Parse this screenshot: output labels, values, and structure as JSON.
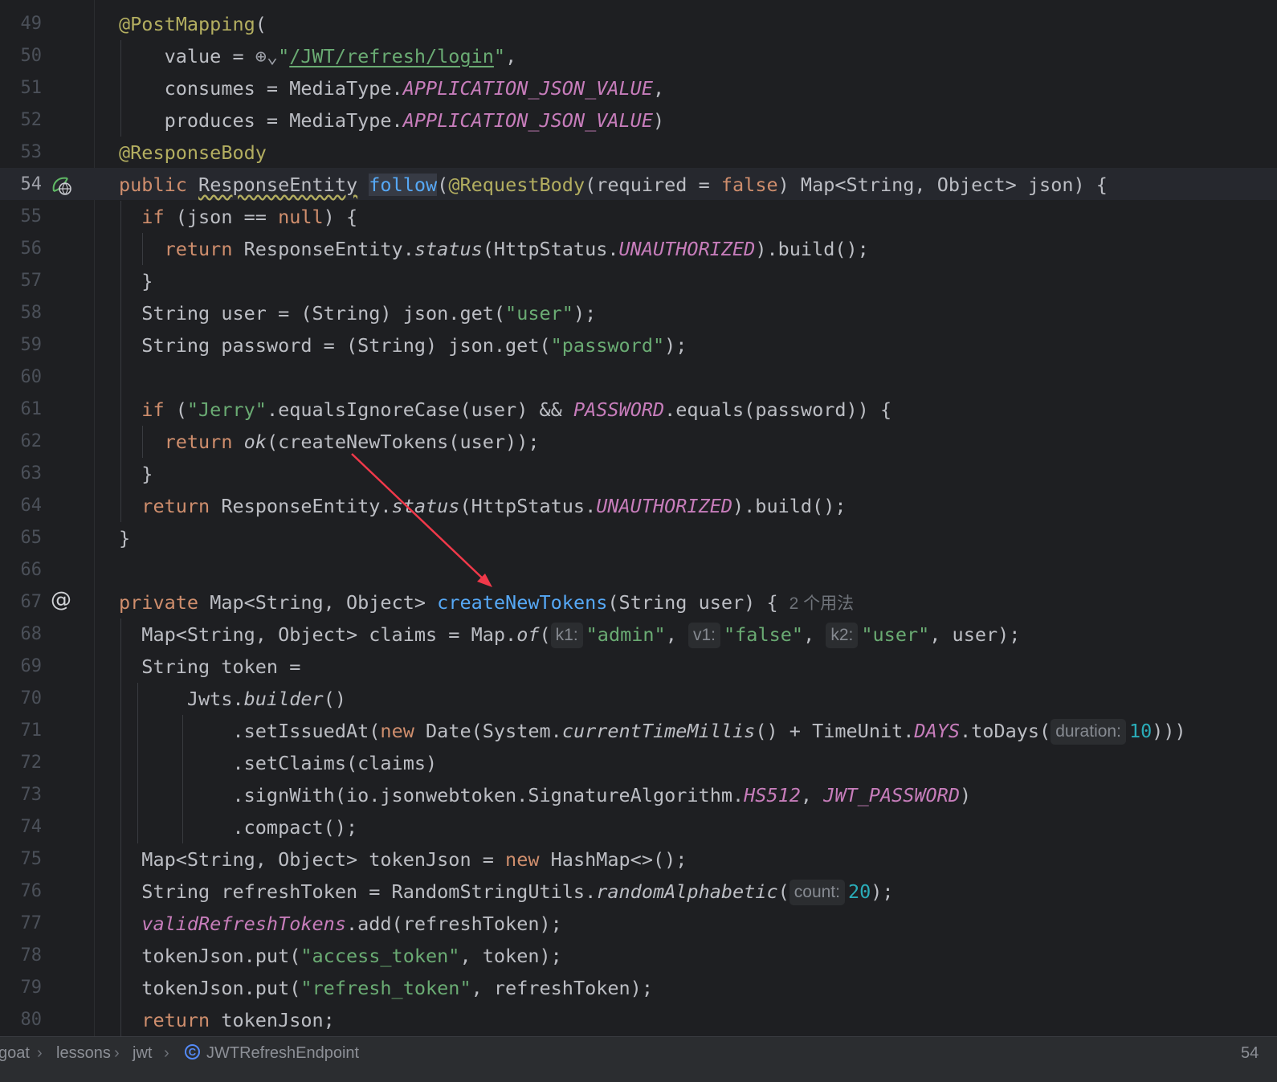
{
  "editor": {
    "lines": [
      {
        "n": "49",
        "html": "<span class=\"ann\">@PostMapping</span>("
      },
      {
        "n": "50",
        "html": "    value = <span data-name=\"globe-icon\" data-interactable=\"true\" style=\"color:#9da0a8\">⊕⌄</span><span class=\"str\">\"<span class=\"link\">/JWT/refresh/login</span>\"</span>,"
      },
      {
        "n": "51",
        "html": "    consumes = MediaType.<span class=\"cst\">APPLICATION_JSON_VALUE</span>,"
      },
      {
        "n": "52",
        "html": "    produces = MediaType.<span class=\"cst\">APPLICATION_JSON_VALUE</span>)"
      },
      {
        "n": "53",
        "html": "<span class=\"ann\">@ResponseBody</span>"
      },
      {
        "n": "54",
        "html": "<span class=\"kw\">public</span> <span class=\"wavy\">ResponseEntity</span> <span class=\"fn hl\">follow</span>(<span class=\"ann\">@RequestBody</span>(required = <span class=\"kw\">false</span>) Map&lt;String, Object&gt; json) {"
      },
      {
        "n": "55",
        "html": "  <span class=\"kw\">if</span> (json == <span class=\"kw\">null</span>) {"
      },
      {
        "n": "56",
        "html": "    <span class=\"kw\">return</span> ResponseEntity.<span class=\"it\">status</span>(HttpStatus.<span class=\"cst\">UNAUTHORIZED</span>).build();"
      },
      {
        "n": "57",
        "html": "  }"
      },
      {
        "n": "58",
        "html": "  String user = (String) json.get(<span class=\"str\">\"user\"</span>);"
      },
      {
        "n": "59",
        "html": "  String password = (String) json.get(<span class=\"str\">\"password\"</span>);"
      },
      {
        "n": "60",
        "html": ""
      },
      {
        "n": "61",
        "html": "  <span class=\"kw\">if</span> (<span class=\"str\">\"Jerry\"</span>.equalsIgnoreCase(user) &amp;&amp; <span class=\"cst\">PASSWORD</span>.equals(password)) {"
      },
      {
        "n": "62",
        "html": "    <span class=\"kw\">return</span> <span class=\"it\">ok</span>(createNewTokens(user));"
      },
      {
        "n": "63",
        "html": "  }"
      },
      {
        "n": "64",
        "html": "  <span class=\"kw\">return</span> ResponseEntity.<span class=\"it\">status</span>(HttpStatus.<span class=\"cst\">UNAUTHORIZED</span>).build();"
      },
      {
        "n": "65",
        "html": "}"
      },
      {
        "n": "66",
        "html": ""
      },
      {
        "n": "67",
        "html": "<span class=\"kw\">private</span> Map&lt;String, Object&gt; <span class=\"fn\">createNewTokens</span>(String user) {<span class=\"usage\">2 个用法</span>"
      },
      {
        "n": "68",
        "html": "  Map&lt;String, Object&gt; claims = Map.<span class=\"it\">of</span>(<span class=\"hint\">k1:</span><span class=\"str\">\"admin\"</span>, <span class=\"hint\">v1:</span><span class=\"str\">\"false\"</span>, <span class=\"hint\">k2:</span><span class=\"str\">\"user\"</span>, user);"
      },
      {
        "n": "69",
        "html": "  String token ="
      },
      {
        "n": "70",
        "html": "      Jwts.<span class=\"it\">builder</span>()"
      },
      {
        "n": "71",
        "html": "          .setIssuedAt(<span class=\"kw\">new</span> Date(System.<span class=\"it\">currentTimeMillis</span>() + TimeUnit.<span class=\"cst\">DAYS</span>.toDays(<span class=\"hint\">duration:</span><span class=\"num\">10</span>)))"
      },
      {
        "n": "72",
        "html": "          .setClaims(claims)"
      },
      {
        "n": "73",
        "html": "          .signWith(io.jsonwebtoken.SignatureAlgorithm.<span class=\"cst\">HS512</span>, <span class=\"cst\">JWT_PASSWORD</span>)"
      },
      {
        "n": "74",
        "html": "          .compact();"
      },
      {
        "n": "75",
        "html": "  Map&lt;String, Object&gt; tokenJson = <span class=\"kw\">new</span> HashMap&lt;&gt;();"
      },
      {
        "n": "76",
        "html": "  String refreshToken = RandomStringUtils.<span class=\"it\">randomAlphabetic</span>(<span class=\"hint\">count:</span><span class=\"num\">20</span>);"
      },
      {
        "n": "77",
        "html": "  <span class=\"cst\">validRefreshTokens</span>.add(refreshToken);"
      },
      {
        "n": "78",
        "html": "  tokenJson.put(<span class=\"str\">\"access_token\"</span>, token);"
      },
      {
        "n": "79",
        "html": "  tokenJson.put(<span class=\"str\">\"refresh_token\"</span>, refreshToken);"
      },
      {
        "n": "80",
        "html": "  <span class=\"kw\">return</span> tokenJson;"
      }
    ]
  },
  "breadcrumb": {
    "items": [
      "goat",
      "lessons",
      "jwt",
      "JWTRefreshEndpoint"
    ],
    "right_text": "54"
  },
  "colors": {
    "background": "#1e1f22",
    "keyword": "#cf8e6d",
    "annotation": "#b3ae60",
    "string": "#6aab73",
    "constant": "#c77dbb",
    "function": "#56a8f5",
    "number": "#2aacb8",
    "arrow": "#f0394a"
  },
  "icons": {
    "line54": "web-endpoint-icon",
    "line67": "at-usages-icon",
    "breadcrumb_class": "class-icon"
  }
}
